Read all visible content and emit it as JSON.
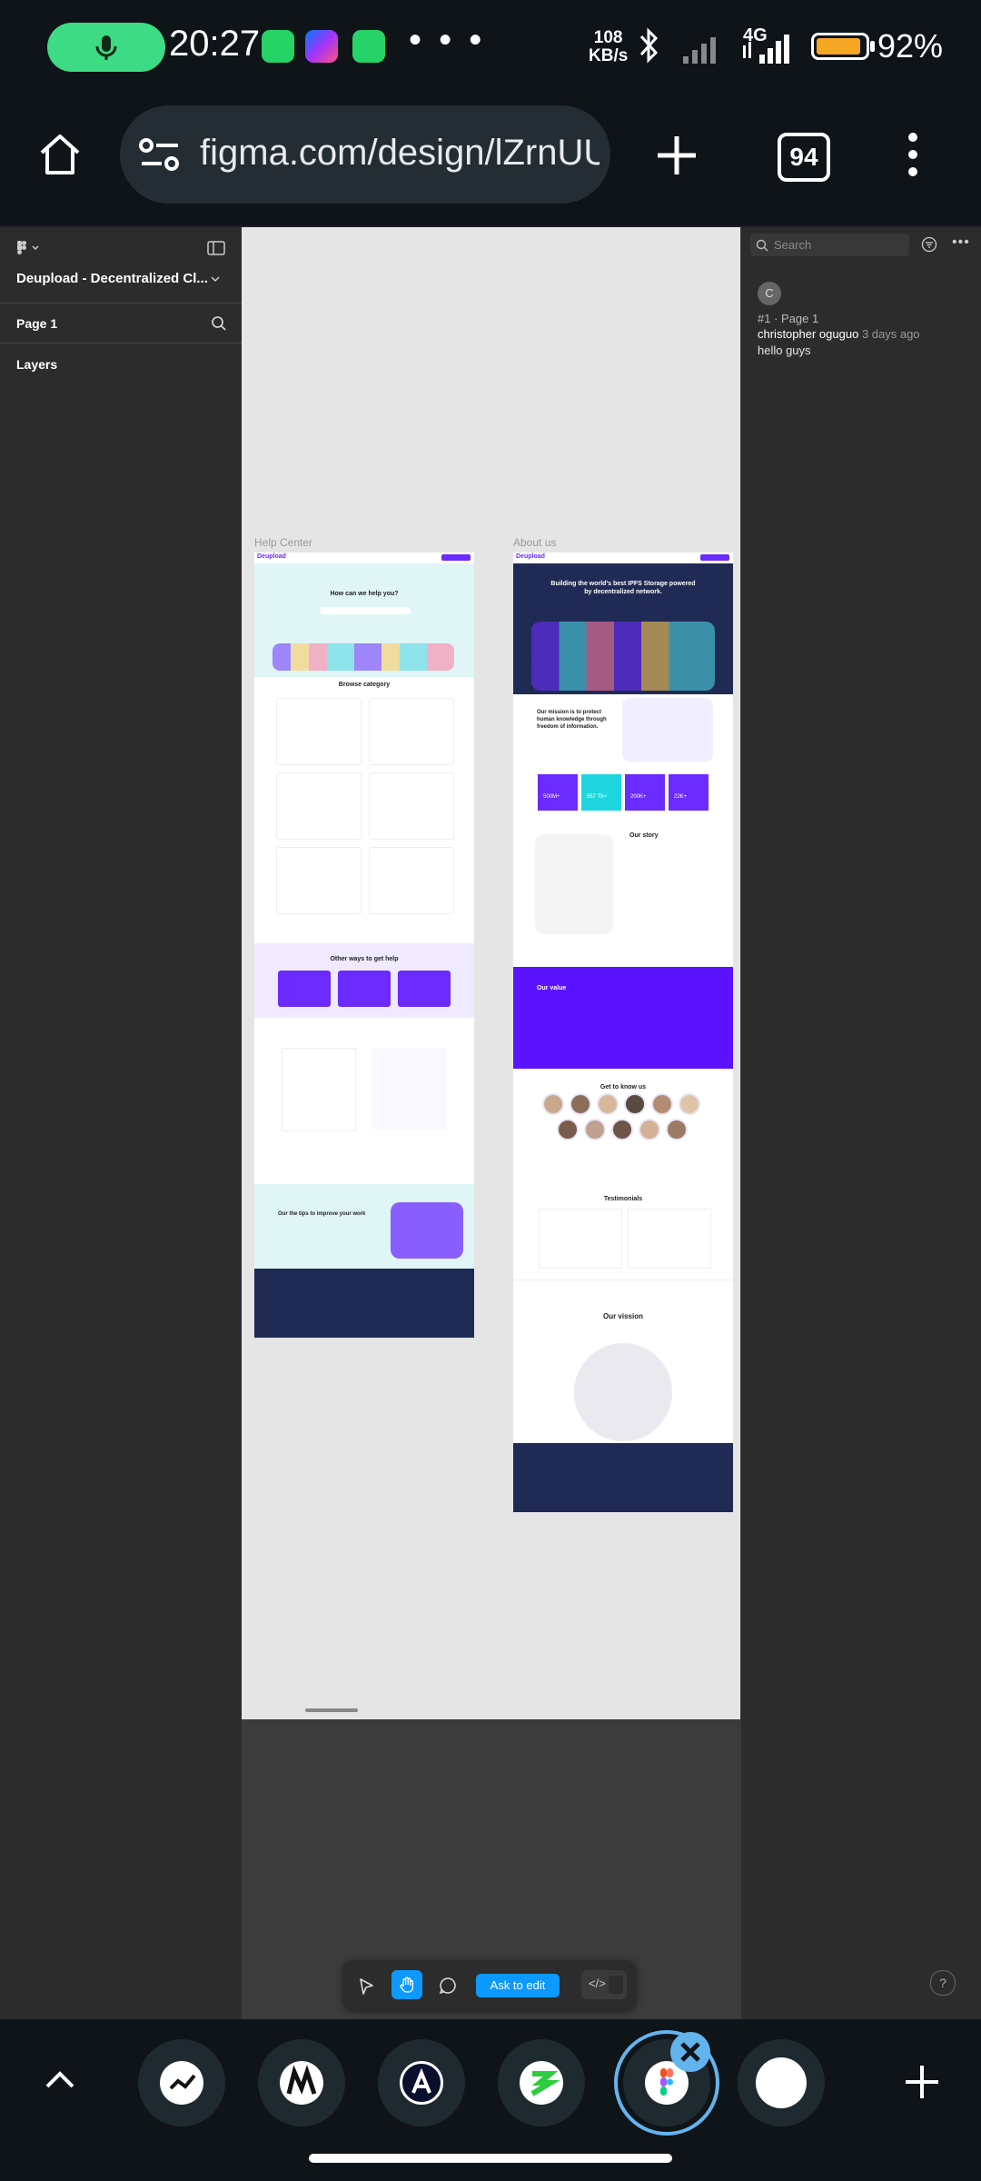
{
  "status_bar": {
    "time": "20:27",
    "overflow": "• • •",
    "net_speed_value": "108",
    "net_speed_unit": "KB/s",
    "network_type": "4G",
    "battery_pct": "92%",
    "battery_level": 0.92,
    "colors": {
      "mic_pill": "#3ddc84",
      "battery_fill": "#f5a623"
    }
  },
  "browser": {
    "url": "figma.com/design/lZrnUU",
    "tab_count": "94"
  },
  "figma": {
    "file_title": "Deupload - Decentralized Cl...",
    "page_name": "Page 1",
    "layers_label": "Layers",
    "search_placeholder": "Search",
    "comment": {
      "avatar_initial": "C",
      "meta": "#1 · Page 1",
      "author": "christopher oguguo",
      "time": "3 days ago",
      "body": "hello guys"
    },
    "toolbar": {
      "ask_to_edit": "Ask to edit",
      "dev_mode": "</>"
    },
    "help": "?",
    "frames": {
      "help_center": {
        "label": "Help Center",
        "logo": "Deupload",
        "hero": "How can we help you?",
        "browse": "Browse category",
        "other_ways": "Other ways to get help",
        "tips": "Our the tips to improve your work"
      },
      "about_us": {
        "label": "About us",
        "logo": "Deupload",
        "hero": "Building the world's best IPFS Storage powered by decentralized network.",
        "mission": "Our mission is to protect human knowledge through freedom of information.",
        "stats": [
          "500M+",
          "567 Tb+",
          "200K+",
          "22K+"
        ],
        "story": "Our story",
        "values": "Our value",
        "know_us": "Get to know us",
        "testimonials": "Testimonials",
        "vision": "Our vission"
      }
    },
    "accent": "#6b2bff"
  },
  "taskbar": {
    "up": "^",
    "add": "+"
  }
}
